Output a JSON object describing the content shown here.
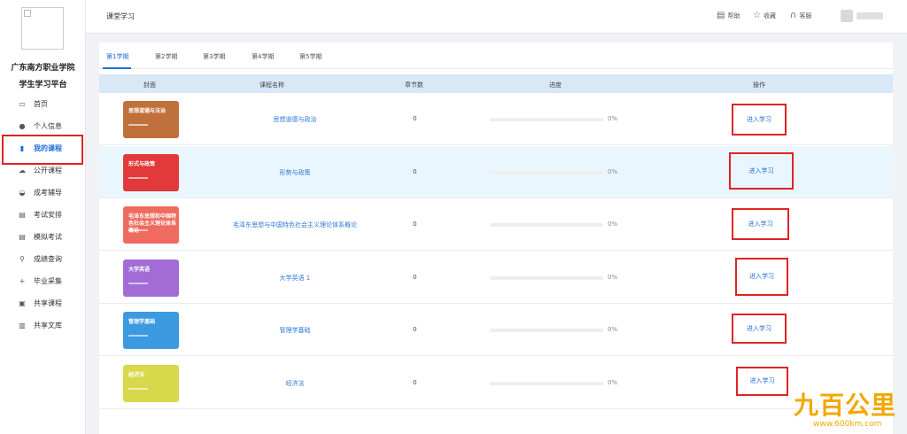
{
  "sidebar": {
    "school_name": "广东南方职业学院",
    "platform_name": "学生学习平台",
    "items": [
      {
        "label": "首页",
        "icon": "monitor-icon",
        "glyph": "▭",
        "active": false
      },
      {
        "label": "个人信息",
        "icon": "user-icon",
        "glyph": "●",
        "active": false
      },
      {
        "label": "我的课程",
        "icon": "book-icon",
        "glyph": "▮",
        "active": true
      },
      {
        "label": "公开课程",
        "icon": "cloud-icon",
        "glyph": "☁",
        "active": false
      },
      {
        "label": "成考辅导",
        "icon": "cap-icon",
        "glyph": "◒",
        "active": false
      },
      {
        "label": "考试安排",
        "icon": "calendar-icon",
        "glyph": "▤",
        "active": false
      },
      {
        "label": "模拟考试",
        "icon": "list-icon",
        "glyph": "▤",
        "active": false
      },
      {
        "label": "成绩查询",
        "icon": "search-icon",
        "glyph": "⚲",
        "active": false
      },
      {
        "label": "毕业采集",
        "icon": "plus-icon",
        "glyph": "+",
        "active": false
      },
      {
        "label": "共享课程",
        "icon": "share-icon",
        "glyph": "▣",
        "active": false
      },
      {
        "label": "共享文库",
        "icon": "document-icon",
        "glyph": "▥",
        "active": false
      }
    ]
  },
  "header": {
    "title": "课堂学习",
    "buttons": {
      "help": {
        "label": "帮助",
        "icon": "help-icon",
        "glyph": "▤"
      },
      "favorite": {
        "label": "收藏",
        "icon": "star-icon",
        "glyph": "☆"
      },
      "service": {
        "label": "客服",
        "icon": "headset-icon",
        "glyph": "∩"
      }
    }
  },
  "tabs": [
    "第1学期",
    "第2学期",
    "第3学期",
    "第4学期",
    "第5学期"
  ],
  "active_tab": 0,
  "table": {
    "headers": {
      "cover": "封面",
      "name": "课程名称",
      "chapters": "章节数",
      "progress": "进度",
      "action": "操作"
    },
    "rows": [
      {
        "cover_title": "思想道德与法治",
        "cover_color": "#c0703a",
        "name": "思想道德与政治",
        "chapters": "0",
        "progress": 0,
        "progress_text": "0%",
        "action": "进入学习",
        "highlight": false
      },
      {
        "cover_title": "形式与政策",
        "cover_color": "#e23a3a",
        "name": "形势与政策",
        "chapters": "0",
        "progress": 0,
        "progress_text": "0%",
        "action": "进入学习",
        "highlight": true
      },
      {
        "cover_title": "毛泽东思想和中国特色社会主义理论体系概论",
        "cover_color": "#ef6b5f",
        "name": "毛泽东思想与中国特色社会主义理论体系概论",
        "chapters": "0",
        "progress": 0,
        "progress_text": "0%",
        "action": "进入学习",
        "highlight": false
      },
      {
        "cover_title": "大学英语",
        "cover_color": "#a26bd6",
        "name": "大学英语 1",
        "chapters": "0",
        "progress": 0,
        "progress_text": "0%",
        "action": "进入学习",
        "highlight": false
      },
      {
        "cover_title": "管理学基础",
        "cover_color": "#3b9ae0",
        "name": "管理学基础",
        "chapters": "0",
        "progress": 0,
        "progress_text": "0%",
        "action": "进入学习",
        "highlight": false
      },
      {
        "cover_title": "经济法",
        "cover_color": "#d9d84a",
        "name": "经济法",
        "chapters": "0",
        "progress": 0,
        "progress_text": "0%",
        "action": "进入学习",
        "highlight": false
      }
    ]
  },
  "watermark": {
    "logo_text": "九百公里",
    "url": "www.600km.com"
  }
}
